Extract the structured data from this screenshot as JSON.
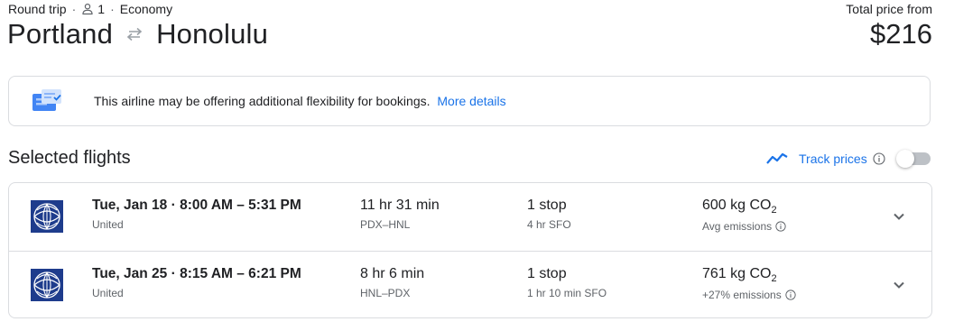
{
  "header": {
    "trip_type": "Round trip",
    "separator": "·",
    "passengers": "1",
    "cabin": "Economy",
    "origin": "Portland",
    "destination": "Honolulu",
    "price_label": "Total price from",
    "price": "$216"
  },
  "banner": {
    "text": "This airline may be offering additional flexibility for bookings.",
    "link": "More details"
  },
  "selected": {
    "title": "Selected flights",
    "track_label": "Track prices",
    "track_enabled": false
  },
  "flights": [
    {
      "date": "Tue, Jan 18",
      "times": "8:00 AM – 5:31 PM",
      "airline": "United",
      "duration": "11 hr 31 min",
      "route": "PDX–HNL",
      "stops": "1 stop",
      "layover": "4 hr SFO",
      "emissions_value": "600 kg CO",
      "emissions_sub": "2",
      "emissions_note": "Avg emissions"
    },
    {
      "date": "Tue, Jan 25",
      "times": "8:15 AM – 6:21 PM",
      "airline": "United",
      "duration": "8 hr 6 min",
      "route": "HNL–PDX",
      "stops": "1 stop",
      "layover": "1 hr 10 min SFO",
      "emissions_value": "761 kg CO",
      "emissions_sub": "2",
      "emissions_note": "+27% emissions"
    }
  ],
  "colors": {
    "accent": "#1a73e8",
    "text": "#202124",
    "secondary": "#5f6368",
    "border": "#dadce0",
    "united_blue": "#1e3c8c"
  },
  "icons": {
    "passenger": "person-outline-icon",
    "swap": "swap-arrows-icon",
    "banner": "flexibility-ticket-icon",
    "track": "trend-line-icon",
    "info": "info-icon",
    "logo": "united-globe-logo",
    "expand": "chevron-down-icon"
  }
}
